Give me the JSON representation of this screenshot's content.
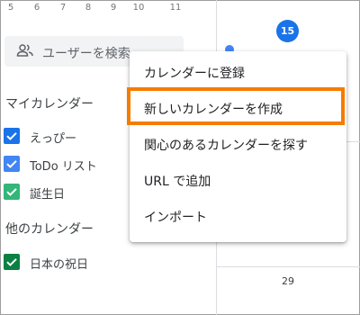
{
  "mini_calendar": {
    "days": [
      "5",
      "6",
      "7",
      "8",
      "9",
      "10",
      "11"
    ]
  },
  "search": {
    "placeholder": "ユーザーを検索"
  },
  "my_calendars": {
    "title": "マイカレンダー",
    "items": [
      {
        "label": "えっぴー",
        "color": "#1a73e8"
      },
      {
        "label": "ToDo リスト",
        "color": "#4285f4"
      },
      {
        "label": "誕生日",
        "color": "#33b679"
      }
    ]
  },
  "other_calendars": {
    "title": "他のカレンダー",
    "items": [
      {
        "label": "日本の祝日",
        "color": "#0b8043"
      }
    ]
  },
  "grid": {
    "today": "15",
    "next_week_day": "29"
  },
  "menu": {
    "items": [
      {
        "label": "カレンダーに登録"
      },
      {
        "label": "新しいカレンダーを作成"
      },
      {
        "label": "関心のあるカレンダーを探す"
      },
      {
        "label": "URL で追加"
      },
      {
        "label": "インポート"
      }
    ],
    "highlight_color": "#f57c00"
  }
}
